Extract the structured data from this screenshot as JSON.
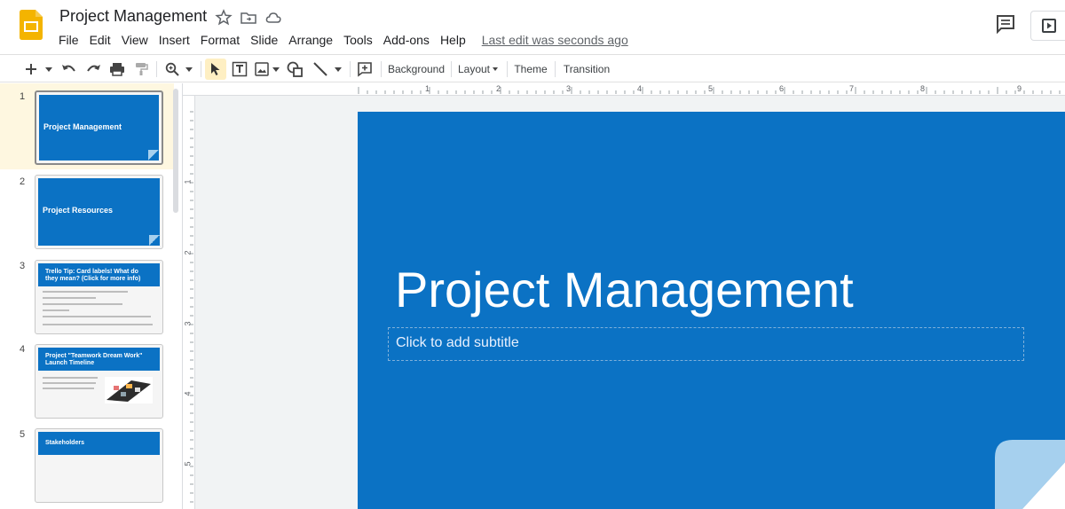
{
  "app": {
    "title": "Project Management",
    "logo_icon": "slides-logo-icon",
    "logo_color": "#f4b400"
  },
  "menu": {
    "items": [
      "File",
      "Edit",
      "View",
      "Insert",
      "Format",
      "Slide",
      "Arrange",
      "Tools",
      "Add-ons",
      "Help"
    ],
    "last_edit": "Last edit was seconds ago"
  },
  "toolbar": {
    "background_label": "Background",
    "layout_label": "Layout",
    "theme_label": "Theme",
    "transition_label": "Transition"
  },
  "filmstrip": {
    "slides": [
      {
        "number": "1",
        "title": "Project Management"
      },
      {
        "number": "2",
        "title": "Project Resources"
      },
      {
        "number": "3",
        "title": "Trello Tip: Card labels! What do they mean? (Click for more info)"
      },
      {
        "number": "4",
        "title": "Project \"Teamwork Dream Work\" Launch Timeline"
      },
      {
        "number": "5",
        "title": "Stakeholders"
      }
    ]
  },
  "ruler": {
    "top_labels": [
      "1",
      "2",
      "3",
      "4",
      "5",
      "6",
      "7",
      "8",
      "9"
    ],
    "left_labels": [
      "1",
      "2",
      "3",
      "4",
      "5"
    ]
  },
  "slide": {
    "title": "Project Management",
    "subtitle_placeholder": "Click to add subtitle",
    "background_color": "#0b72c4",
    "accent_color": "#a6d0ee"
  }
}
